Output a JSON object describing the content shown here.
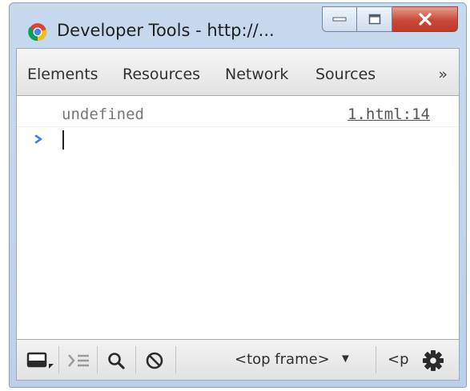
{
  "window": {
    "title": "Developer Tools - http://...",
    "controls": {
      "minimize": "minimize",
      "maximize": "maximize",
      "close": "close"
    }
  },
  "tabs": [
    {
      "label": "Elements"
    },
    {
      "label": "Resources"
    },
    {
      "label": "Network"
    },
    {
      "label": "Sources"
    }
  ],
  "tabs_overflow": "»",
  "console": {
    "log": {
      "text": "undefined",
      "source": "1.html:14"
    },
    "prompt_symbol": "›",
    "input_value": ""
  },
  "statusbar": {
    "icons": [
      "dock-icon",
      "show-console-icon",
      "search-icon",
      "clear-console-icon",
      "settings-icon"
    ],
    "frame_select": "<top frame>",
    "frame_arrow": "▼",
    "second_select": "<p"
  },
  "colors": {
    "title_bar": "#bcd0e9",
    "close_button": "#c74938",
    "prompt": "#3b85d8",
    "log_text": "#777777"
  }
}
